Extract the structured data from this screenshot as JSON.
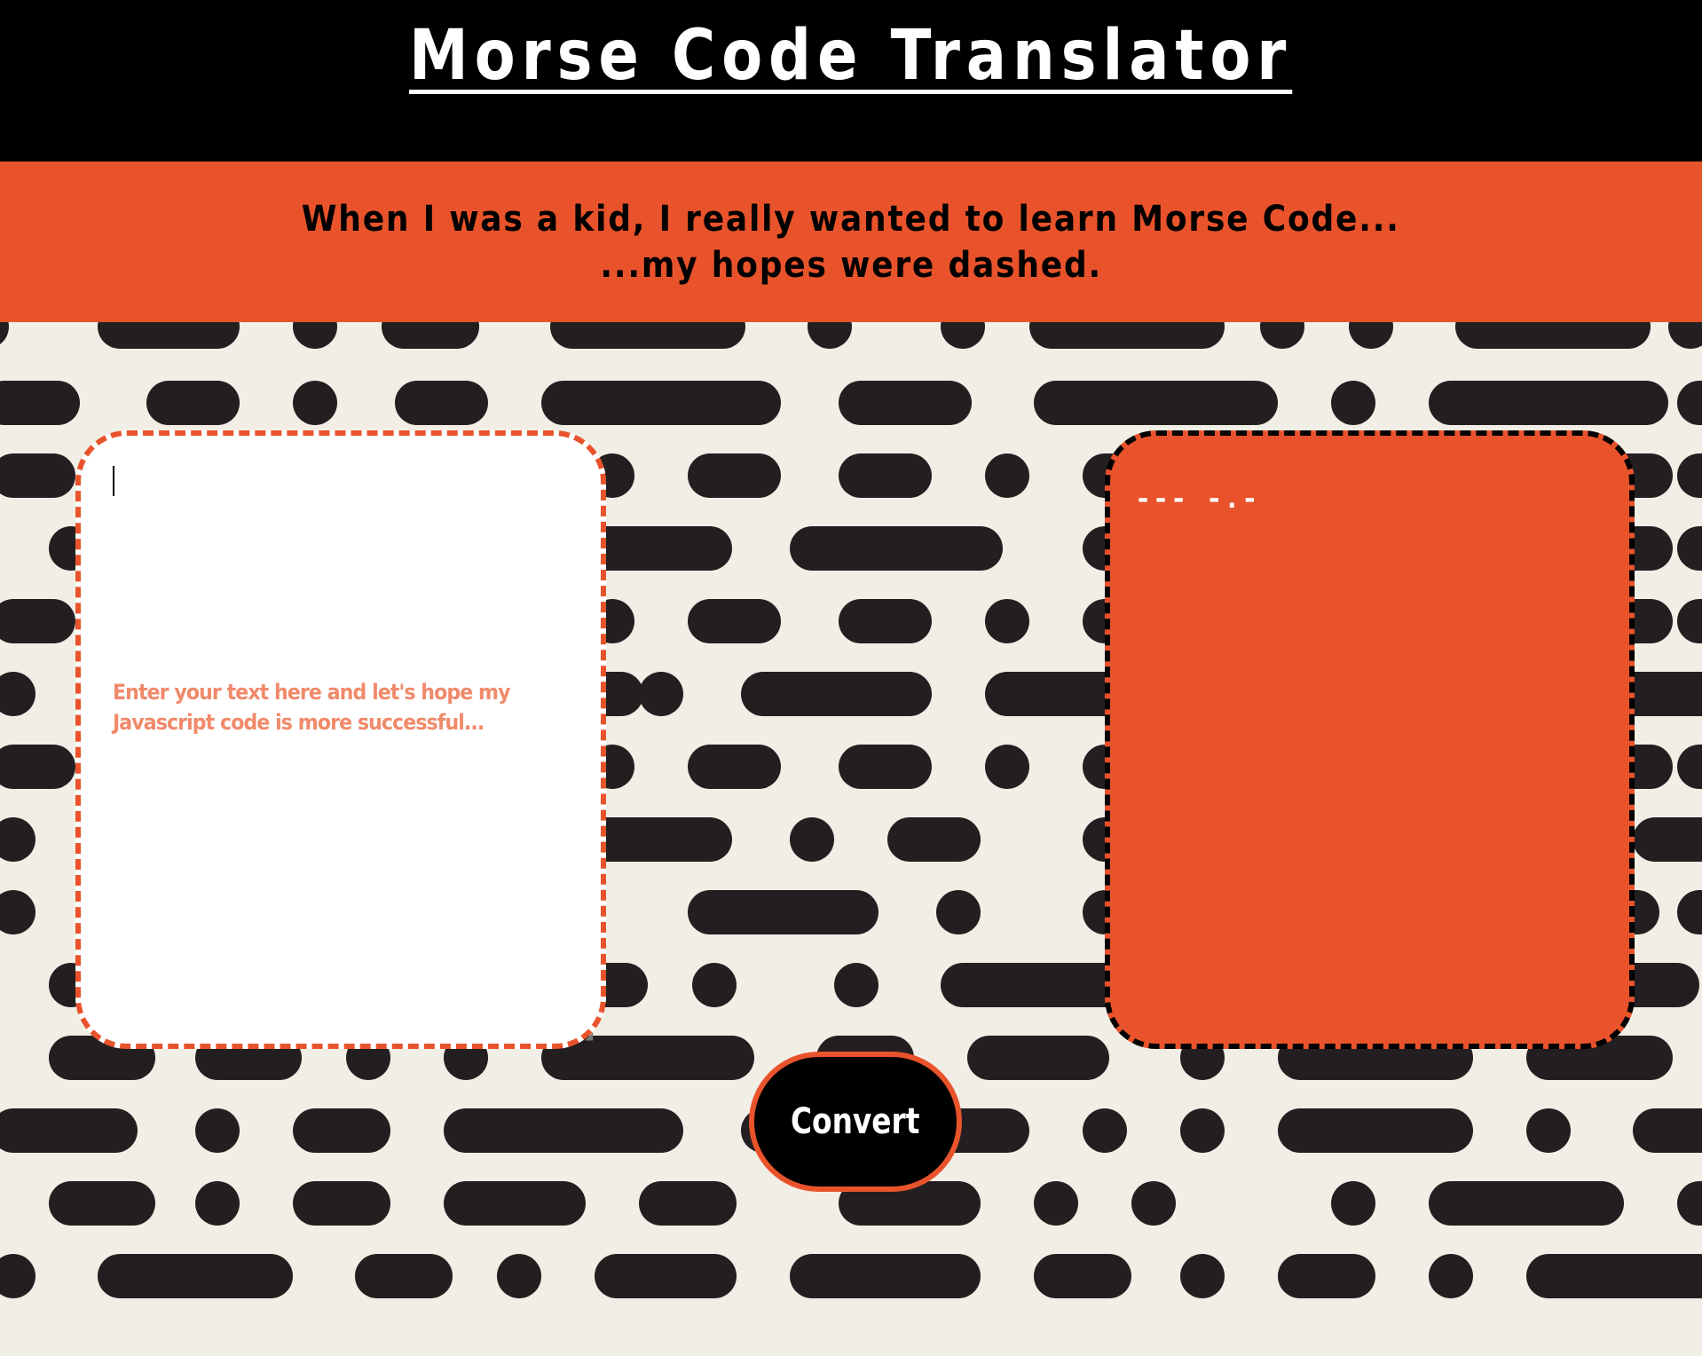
{
  "header": {
    "title": "Morse Code Translator"
  },
  "banner": {
    "line1": "When I was a kid, I really wanted to learn Morse Code...",
    "line2": "...my hopes were dashed."
  },
  "input": {
    "placeholder": "Enter your text here and let's hope my Javascript code is more successful...",
    "value": ""
  },
  "output": {
    "text": "--- -.-"
  },
  "convert_button": {
    "label": "Convert"
  },
  "colors": {
    "header_bg": "#000000",
    "accent_orange": "#e9532b",
    "pattern_bg": "#f1eee6",
    "pattern_ink": "#231f20",
    "placeholder": "#f08a6b"
  },
  "icons": {
    "background": "morse-dots-dashes-pattern",
    "resize": "resize-grip-icon"
  }
}
